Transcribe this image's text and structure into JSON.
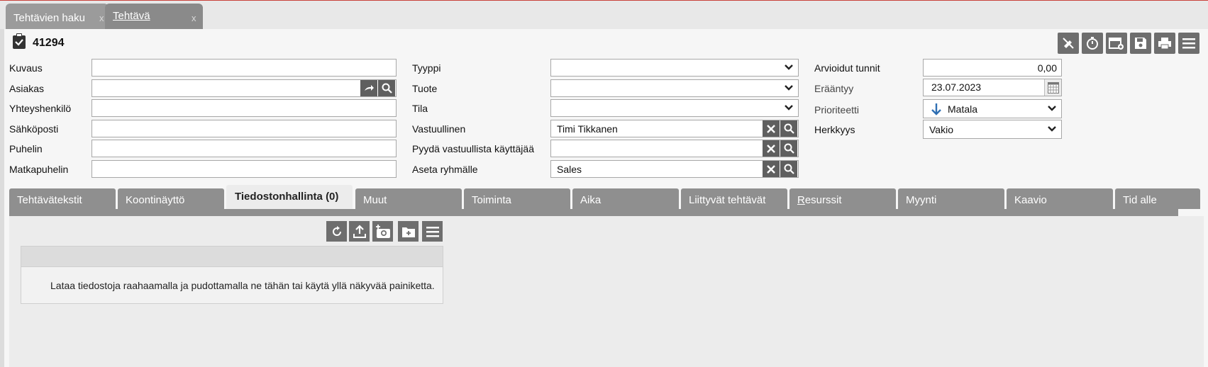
{
  "window_tabs": [
    {
      "label": "Tehtävien haku",
      "close": "x"
    },
    {
      "label": "Tehtävä",
      "close": "x"
    }
  ],
  "record": {
    "id": "41294"
  },
  "toolbar": {
    "buttons": [
      "unassign-icon",
      "stopwatch-icon",
      "calendar-add-icon",
      "save-icon",
      "print-icon",
      "menu-icon"
    ]
  },
  "form": {
    "col1": [
      {
        "label": "Kuvaus",
        "value": ""
      },
      {
        "label": "Asiakas",
        "value": ""
      },
      {
        "label": "Yhteyshenkilö",
        "value": ""
      },
      {
        "label": "Sähköposti",
        "value": ""
      },
      {
        "label": "Puhelin",
        "value": ""
      },
      {
        "label": "Matkapuhelin",
        "value": ""
      }
    ],
    "col2": [
      {
        "label": "Tyyppi",
        "value": ""
      },
      {
        "label": "Tuote",
        "value": ""
      },
      {
        "label": "Tila",
        "value": ""
      },
      {
        "label": "Vastuullinen",
        "value": "Timi Tikkanen"
      },
      {
        "label": "Pyydä vastuullista käyttäjää",
        "value": ""
      },
      {
        "label": "Aseta ryhmälle",
        "value": "Sales"
      }
    ],
    "col3": [
      {
        "label": "Arvioidut tunnit",
        "value": "0,00"
      },
      {
        "label": "Erääntyy",
        "value": "23.07.2023"
      },
      {
        "label": "Prioriteetti",
        "value": "Matala"
      },
      {
        "label": "Herkkyys",
        "value": "Vakio"
      }
    ]
  },
  "tabs": [
    {
      "label": "Tehtävätekstit"
    },
    {
      "label": "Koontinäyttö"
    },
    {
      "label": "Tiedostonhallinta (0)",
      "active": true
    },
    {
      "label": "Muut"
    },
    {
      "label": "Toiminta"
    },
    {
      "label": "Aika"
    },
    {
      "label": "Liittyvät tehtävät"
    },
    {
      "label": "Resurssit"
    },
    {
      "label": "Myynti"
    },
    {
      "label": "Kaavio"
    },
    {
      "label": "Tid alle"
    }
  ],
  "files": {
    "toolbar": [
      "refresh-icon",
      "upload-icon",
      "camera-add-icon",
      "new-folder-icon",
      "menu-icon"
    ],
    "drop_text": "Lataa tiedostoja raahaamalla ja pudottamalla ne tähän tai käytä yllä näkyvää painiketta."
  },
  "colors": {
    "button_bg": "#6e6e6e",
    "tab_bg": "#8f8f8f",
    "priority_arrow": "#2f6fb3"
  }
}
